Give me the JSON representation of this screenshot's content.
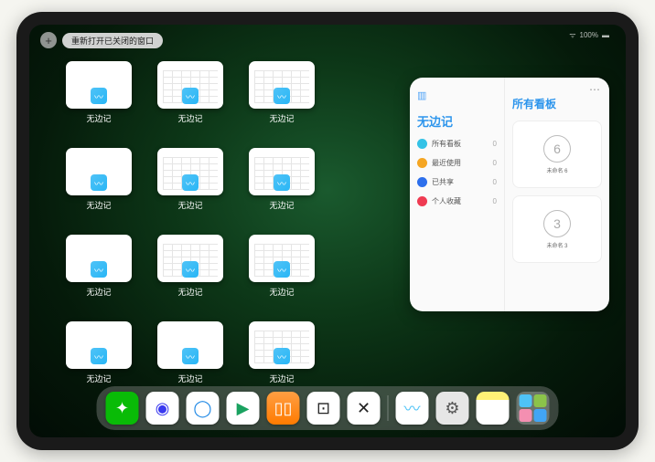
{
  "status": {
    "battery": "100%",
    "wifi": "⋮⋮"
  },
  "topbar": {
    "plus": "+",
    "reopen": "重新打开已关闭的窗口"
  },
  "app_label": "无边记",
  "grid": [
    {
      "variant": "blank"
    },
    {
      "variant": "grid"
    },
    {
      "variant": "grid"
    },
    {
      "variant": "blank"
    },
    {
      "variant": "grid"
    },
    {
      "variant": "grid"
    },
    {
      "variant": "blank"
    },
    {
      "variant": "grid"
    },
    {
      "variant": "grid"
    },
    {
      "variant": "blank"
    },
    {
      "variant": "blank"
    },
    {
      "variant": "grid"
    }
  ],
  "panel": {
    "left_title": "无边记",
    "right_title": "所有看板",
    "categories": [
      {
        "label": "所有看板",
        "count": "0",
        "color": "#34c2e6"
      },
      {
        "label": "最近使用",
        "count": "0",
        "color": "#f5a623"
      },
      {
        "label": "已共享",
        "count": "0",
        "color": "#2d6fec"
      },
      {
        "label": "个人收藏",
        "count": "0",
        "color": "#ef3b52"
      }
    ],
    "boards": [
      {
        "sketch": "6",
        "name": "未命名 6",
        "sub": ""
      },
      {
        "sketch": "3",
        "name": "未命名 3",
        "sub": ""
      }
    ]
  },
  "dock": [
    {
      "name": "wechat",
      "bg": "#09bb07",
      "glyph": "✦",
      "color": "#fff"
    },
    {
      "name": "quark-hd",
      "bg": "#fff",
      "glyph": "◉",
      "color": "#3a3aef"
    },
    {
      "name": "qq-browser",
      "bg": "#fff",
      "glyph": "◯",
      "color": "#1e88e5"
    },
    {
      "name": "video",
      "bg": "#fff",
      "glyph": "▶",
      "color": "#1aa260"
    },
    {
      "name": "books",
      "bg": "linear-gradient(#ff9f43,#ff7b00)",
      "glyph": "▯▯",
      "color": "#fff"
    },
    {
      "name": "dice",
      "bg": "#fff",
      "glyph": "⊡",
      "color": "#222"
    },
    {
      "name": "connect",
      "bg": "#fff",
      "glyph": "✕",
      "color": "#222"
    }
  ],
  "dock_right": [
    {
      "name": "freeform",
      "bg": "#fff",
      "glyph": "〰",
      "color": "#4fc3f7"
    },
    {
      "name": "settings",
      "bg": "#e6e6e6",
      "glyph": "⚙",
      "color": "#555"
    },
    {
      "name": "notes",
      "bg": "linear-gradient(#fff176 25%,#fff 25%)",
      "glyph": "",
      "color": "#333"
    }
  ]
}
